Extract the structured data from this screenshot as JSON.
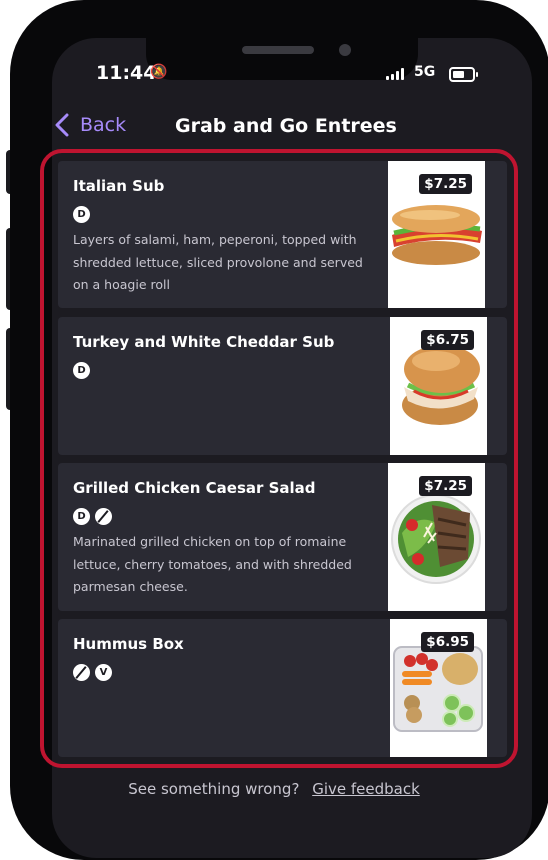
{
  "status_bar": {
    "time": "11:44",
    "network": "5G"
  },
  "nav": {
    "back_label": "Back",
    "title": "Grab and Go Entrees"
  },
  "items": [
    {
      "name": "Italian Sub",
      "badges": [
        "D"
      ],
      "description": "Layers of salami, ham, peperoni, topped with shredded lettuce, sliced provolone and served on a hoagie roll",
      "price": "$7.25",
      "image": "italian-sub"
    },
    {
      "name": "Turkey and White Cheddar Sub",
      "badges": [
        "D"
      ],
      "description": "",
      "price": "$6.75",
      "image": "turkey-sub"
    },
    {
      "name": "Grilled Chicken Caesar Salad",
      "badges": [
        "D",
        "GF"
      ],
      "description": "Marinated grilled chicken on top of romaine lettuce, cherry tomatoes, and with shredded parmesan cheese.",
      "price": "$7.25",
      "image": "caesar-salad"
    },
    {
      "name": "Hummus Box",
      "badges": [
        "GF",
        "V"
      ],
      "description": "",
      "price": "$6.95",
      "image": "hummus-box"
    }
  ],
  "footer": {
    "prompt": "See something wrong?",
    "link": "Give feedback"
  },
  "colors": {
    "accent": "#a78bfa",
    "highlight": "#bf1430",
    "background": "#1c1b21",
    "card": "#2a2a33"
  }
}
